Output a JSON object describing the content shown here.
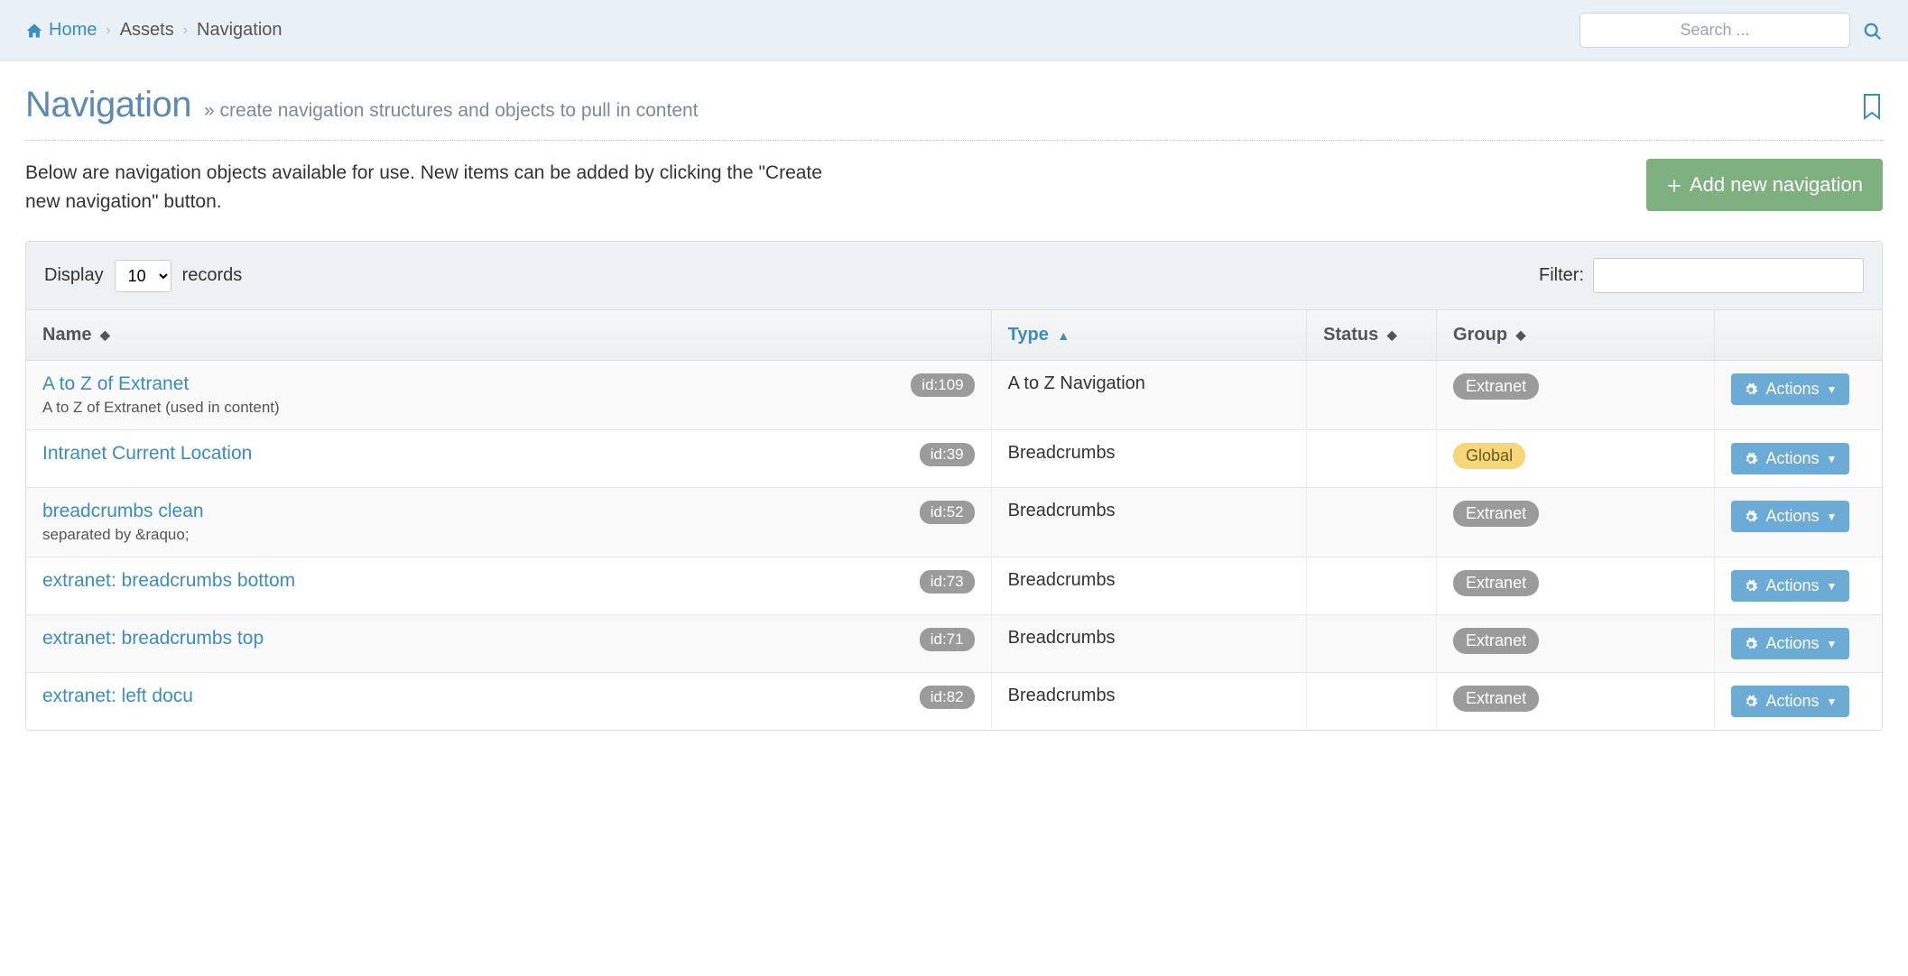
{
  "breadcrumb": {
    "home": "Home",
    "assets": "Assets",
    "current": "Navigation"
  },
  "search": {
    "placeholder": "Search ..."
  },
  "header": {
    "title": "Navigation",
    "subtitle": "» create navigation structures and objects to pull in content"
  },
  "intro": "Below are navigation objects available for use. New items can be added by clicking the \"Create new navigation\" button.",
  "add_button": "Add new navigation",
  "table_controls": {
    "display_label": "Display",
    "display_value": "10",
    "records_label": "records",
    "filter_label": "Filter:"
  },
  "columns": {
    "name": "Name",
    "type": "Type",
    "status": "Status",
    "group": "Group"
  },
  "actions_label": "Actions",
  "rows": [
    {
      "name": "A to Z of Extranet",
      "desc": "A to Z of Extranet (used in content)",
      "id": "id:109",
      "type": "A to Z Navigation",
      "status": "",
      "group": "Extranet",
      "group_kind": "extranet"
    },
    {
      "name": "Intranet Current Location",
      "desc": "",
      "id": "id:39",
      "type": "Breadcrumbs",
      "status": "",
      "group": "Global",
      "group_kind": "global"
    },
    {
      "name": "breadcrumbs clean",
      "desc": "separated by &raquo;",
      "id": "id:52",
      "type": "Breadcrumbs",
      "status": "",
      "group": "Extranet",
      "group_kind": "extranet"
    },
    {
      "name": "extranet: breadcrumbs bottom",
      "desc": "",
      "id": "id:73",
      "type": "Breadcrumbs",
      "status": "",
      "group": "Extranet",
      "group_kind": "extranet"
    },
    {
      "name": "extranet: breadcrumbs top",
      "desc": "",
      "id": "id:71",
      "type": "Breadcrumbs",
      "status": "",
      "group": "Extranet",
      "group_kind": "extranet"
    },
    {
      "name": "extranet: left docu",
      "desc": "",
      "id": "id:82",
      "type": "Breadcrumbs",
      "status": "",
      "group": "Extranet",
      "group_kind": "extranet"
    }
  ]
}
